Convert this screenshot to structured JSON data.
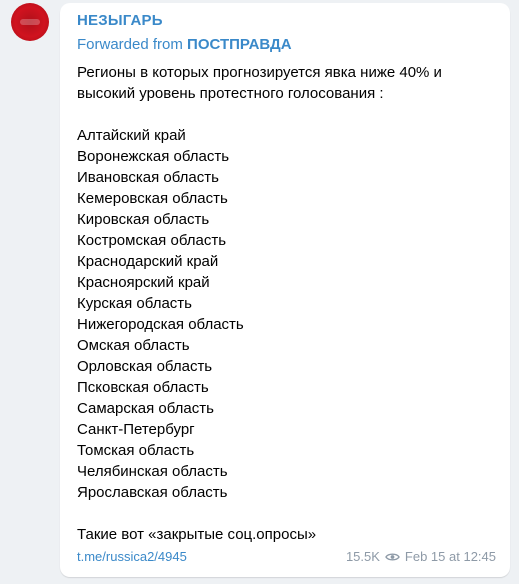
{
  "post": {
    "channel_name": "НЕЗЫГАРЬ",
    "forwarded_prefix": "Forwarded from",
    "forwarded_source": "ПОСТПРАВДА",
    "intro": "Регионы в которых прогнозируется явка ниже 40% и высокий уровень протестного голосования :",
    "regions": [
      "Алтайский край",
      "Воронежская область",
      "Ивановская область",
      "Кемеровская область",
      "Кировская область",
      "Костромская область",
      "Краснодарский край",
      "Красноярский край",
      "Курская область",
      "Нижегородская область",
      "Омская область",
      "Орловская область",
      "Псковская область",
      "Самарская область",
      "Санкт-Петербург",
      "Томская область",
      "Челябинская область",
      "Ярославская область"
    ],
    "closing": "Такие вот «закрытые соц.опросы»",
    "link": "t.me/russica2/4945",
    "views": "15.5K",
    "timestamp": "Feb 15 at 12:45"
  },
  "colors": {
    "accent": "#3a89c9",
    "avatar": "#d0131f",
    "meta": "#8e9aa7",
    "background": "#eef1f4"
  },
  "icons": {
    "views": "eye-icon"
  }
}
